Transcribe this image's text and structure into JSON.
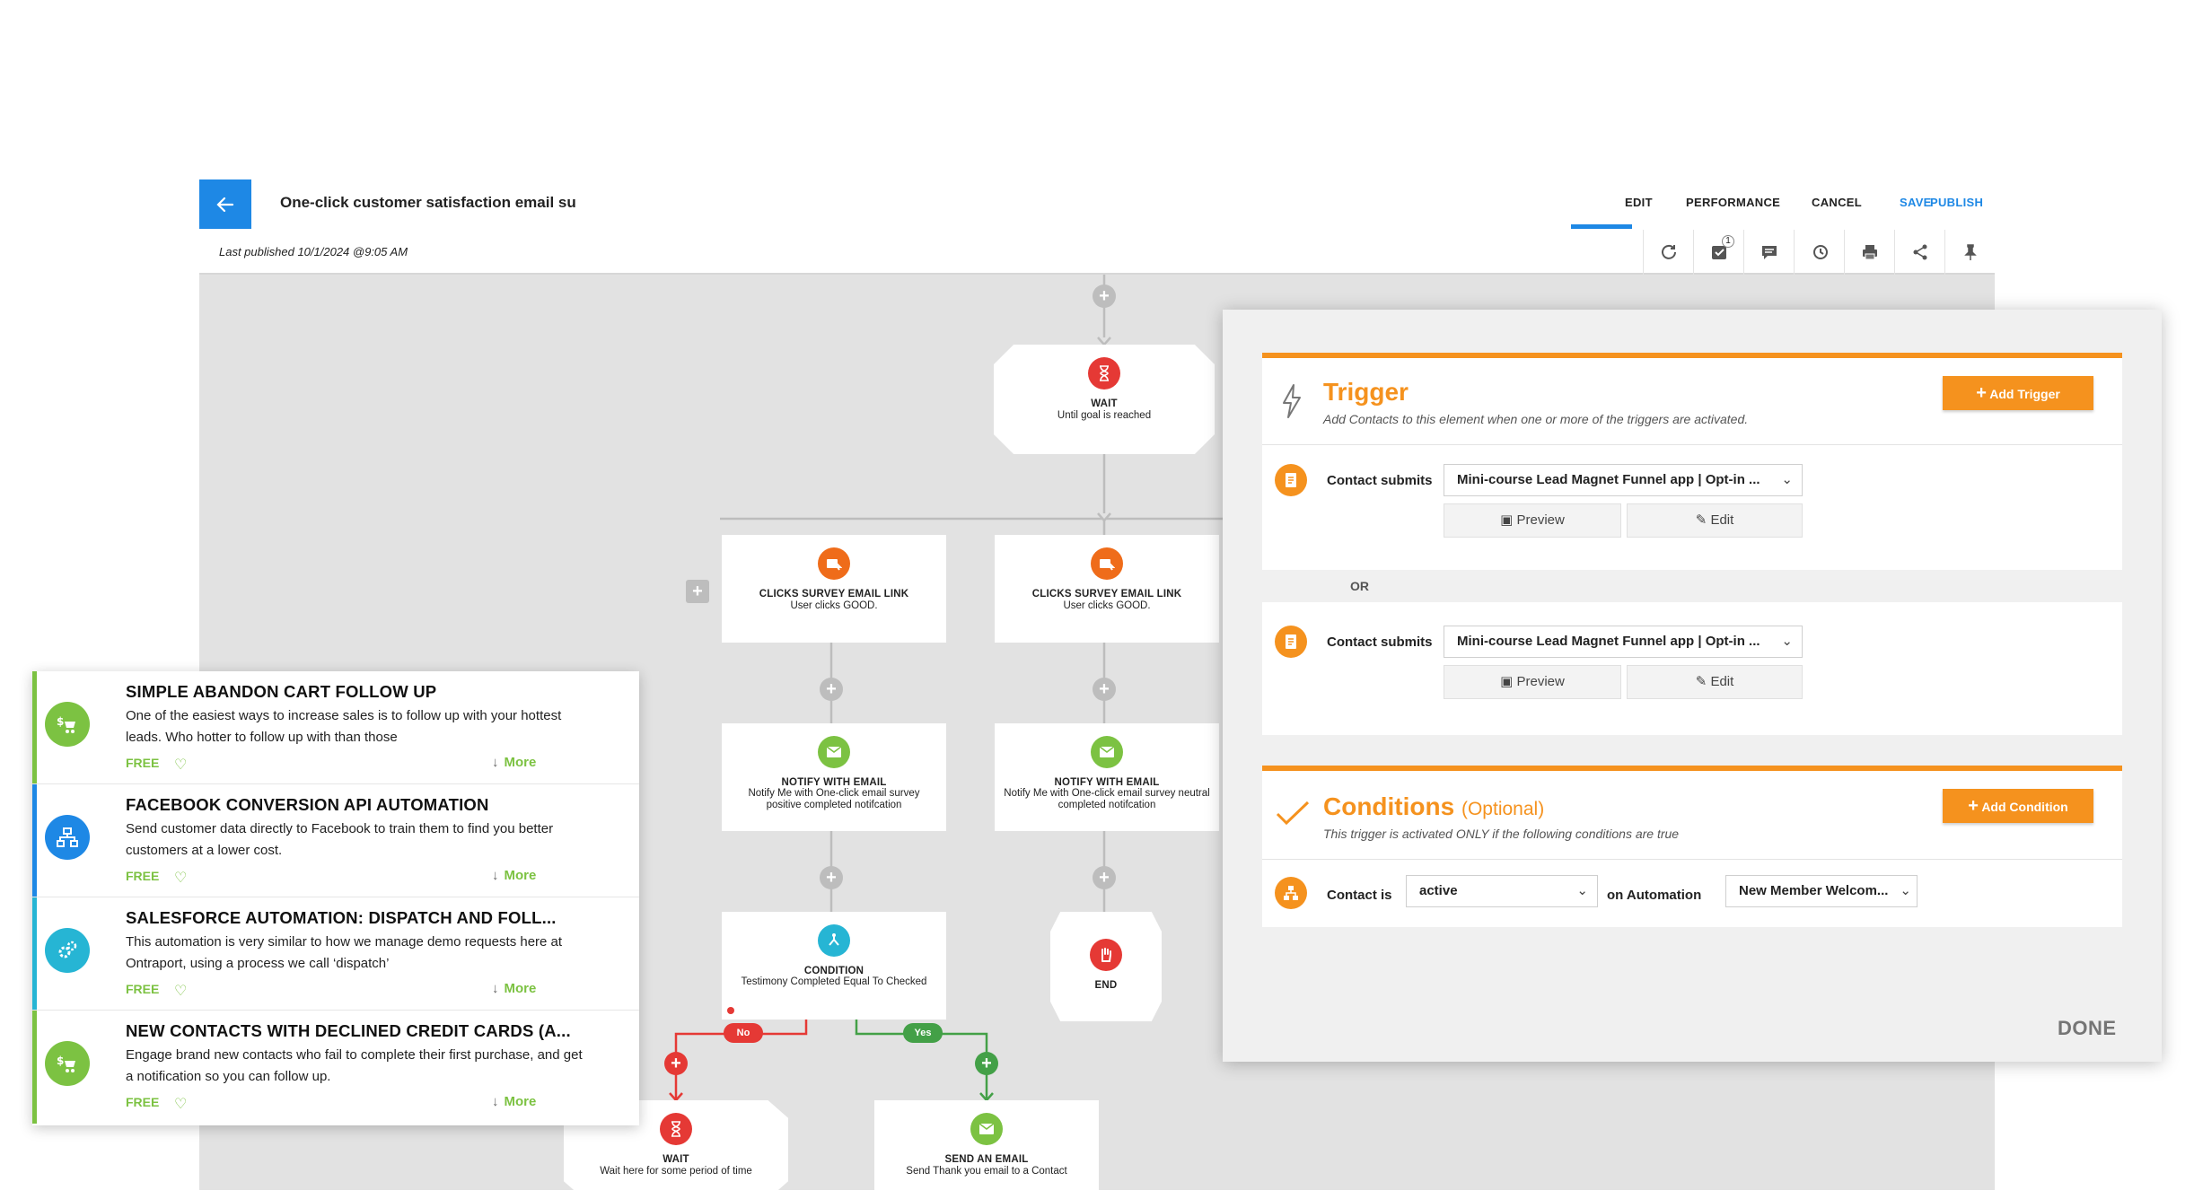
{
  "header": {
    "title": "One-click customer satisfaction email su",
    "last_published": "Last published 10/1/2024 @9:05 AM",
    "nav": {
      "edit": "EDIT",
      "performance": "PERFORMANCE",
      "cancel": "CANCEL",
      "save": "SAVE",
      "publish": "PUBLISH"
    },
    "tool_badge": "1",
    "icons": [
      "refresh-icon",
      "tasks-icon",
      "comment-icon",
      "history-icon",
      "print-icon",
      "share-icon",
      "pin-icon"
    ]
  },
  "canvas": {
    "wait_top": {
      "title": "WAIT",
      "sub": "Until goal is reached"
    },
    "clicks_left": {
      "title": "CLICKS SURVEY EMAIL LINK",
      "sub": "User clicks GOOD."
    },
    "clicks_right": {
      "title": "CLICKS SURVEY EMAIL LINK",
      "sub": "User clicks GOOD."
    },
    "notify_left": {
      "title": "NOTIFY WITH EMAIL",
      "sub": "Notify Me with One-click email survey positive completed notifcation"
    },
    "notify_right": {
      "title": "NOTIFY WITH EMAIL",
      "sub": "Notify Me with One-click email survey neutral completed notifcation"
    },
    "condition": {
      "title": "CONDITION",
      "sub": "Testimony Completed Equal To Checked"
    },
    "end": {
      "title": "END"
    },
    "no_label": "No",
    "yes_label": "Yes",
    "wait_bottom": {
      "title": "WAIT",
      "sub": "Wait here for some period of time"
    },
    "send_email": {
      "title": "SEND AN EMAIL",
      "sub": "Send Thank you email to a Contact"
    }
  },
  "panel": {
    "trigger": {
      "title": "Trigger",
      "desc": "Add Contacts to this element when one or more of the triggers are activated.",
      "add_button": "Add Trigger",
      "rows": [
        {
          "label": "Contact submits",
          "select": "Mini-course Lead Magnet Funnel app | Opt-in ...",
          "preview": "Preview",
          "edit": "Edit"
        },
        {
          "label": "Contact submits",
          "select": "Mini-course Lead Magnet Funnel app | Opt-in ...",
          "preview": "Preview",
          "edit": "Edit"
        }
      ],
      "or": "OR"
    },
    "conditions": {
      "title": "Conditions",
      "optional": "(Optional)",
      "desc": "This trigger is activated ONLY if the following conditions are true",
      "add_button": "Add Condition",
      "label": "Contact is",
      "status_select": "active",
      "mid_label": "on Automation",
      "automation_select": "New Member Welcom..."
    },
    "done": "DONE"
  },
  "templates": [
    {
      "title": "SIMPLE ABANDON CART FOLLOW UP",
      "desc": "One of the easiest ways to increase sales is to follow up with your hottest leads. Who hotter to follow up with than those",
      "price": "FREE",
      "more": "More",
      "color": "#7cc242"
    },
    {
      "title": "FACEBOOK CONVERSION API AUTOMATION",
      "desc": "Send customer data directly to Facebook to train them to find you better customers at a lower cost.",
      "price": "FREE",
      "more": "More",
      "color": "#1e88e5"
    },
    {
      "title": "SALESFORCE AUTOMATION: DISPATCH AND FOLL...",
      "desc": "This automation is very similar to how we manage demo requests here at Ontraport, using a process we call ‘dispatch’",
      "price": "FREE",
      "more": "More",
      "color": "#26b5d4"
    },
    {
      "title": "NEW CONTACTS WITH DECLINED CREDIT CARDS (A...",
      "desc": "Engage brand new contacts who fail to complete their first purchase, and get a notification so you can follow up.",
      "price": "FREE",
      "more": "More",
      "color": "#7cc242"
    }
  ],
  "colors": {
    "accent_blue": "#1e88e5",
    "accent_orange": "#f5921e",
    "green": "#7cc242",
    "red": "#e53935"
  }
}
